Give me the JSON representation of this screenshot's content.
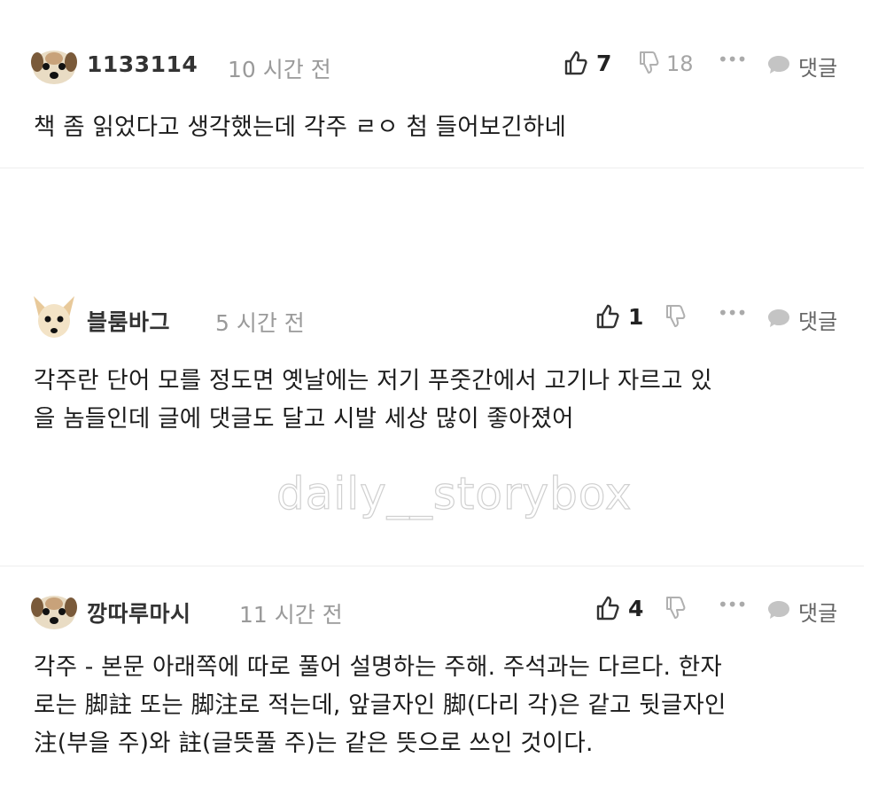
{
  "comments": [
    {
      "username": "1133114",
      "time": "10 시간 전",
      "likes": "7",
      "dislikes": "18",
      "more": "•••",
      "reply_label": "댓글",
      "text": "책 좀 읽었다고 생각했는데 각주 ㄹㅇ 첨 들어보긴하네",
      "avatar": "dog-face-icon"
    },
    {
      "username": "블룸바그",
      "time": "5 시간 전",
      "likes": "1",
      "more": "•••",
      "reply_label": "댓글",
      "text": "각주란 단어 모를 정도면 옛날에는 저기 푸줏간에서 고기나 자르고 있\n을 놈들인데 글에 댓글도 달고 시발 세상 많이 좋아졌어",
      "avatar": "chihuahua-face-icon"
    },
    {
      "username": "깡따루마시",
      "time": "11 시간 전",
      "likes": "4",
      "more": "•••",
      "reply_label": "댓글",
      "text": "각주 - 본문 아래쪽에 따로 풀어 설명하는 주해. 주석과는 다르다. 한자\n로는 脚註 또는 脚注로 적는데, 앞글자인 脚(다리 각)은 같고 뒷글자인\n注(부을 주)와 註(글뜻풀 주)는 같은 뜻으로 쓰인 것이다.",
      "avatar": "dog-face-icon"
    }
  ],
  "watermark": "daily__storybox",
  "colors": {
    "username": "#333333",
    "time": "#9a9a9a",
    "icon": "#555555",
    "dislike_count": "#a5a5a5",
    "divider": "#eeeeee"
  }
}
